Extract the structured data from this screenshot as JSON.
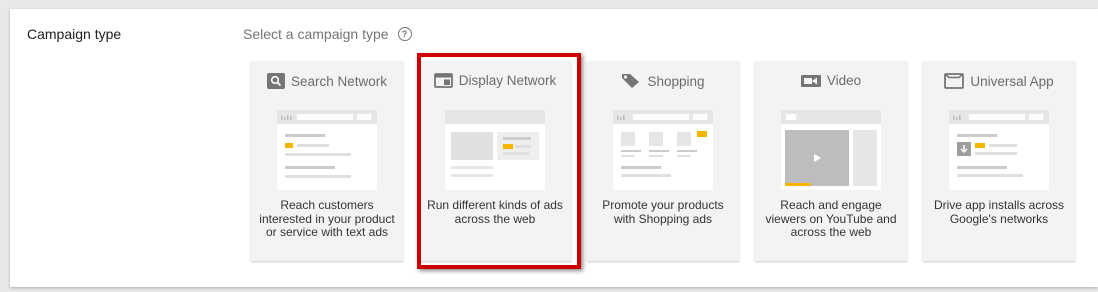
{
  "section": {
    "label": "Campaign type",
    "prompt": "Select a campaign type"
  },
  "cards": [
    {
      "title": "Search Network",
      "icon": "search-icon",
      "description": "Reach customers interested in your product or service with text ads"
    },
    {
      "title": "Display Network",
      "icon": "display-icon",
      "description": "Run different kinds of ads across the web"
    },
    {
      "title": "Shopping",
      "icon": "tag-icon",
      "description": "Promote your products with Shopping ads"
    },
    {
      "title": "Video",
      "icon": "video-camera-icon",
      "description": "Reach and engage viewers on YouTube and across the web"
    },
    {
      "title": "Universal App",
      "icon": "app-icon",
      "description": "Drive app installs across Google's networks"
    }
  ],
  "selected_card": "Display Network",
  "colors": {
    "highlight": "#cc0000",
    "accent": "#f4b400",
    "icon": "#757575"
  }
}
